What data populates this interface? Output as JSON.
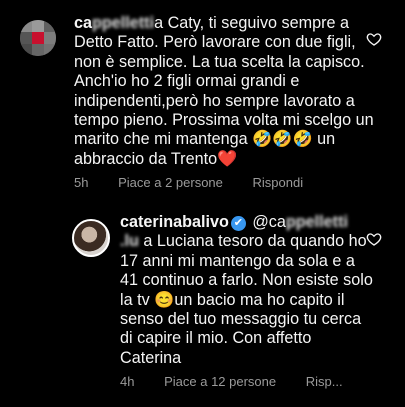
{
  "comment1": {
    "username": "ca",
    "username_blurred": "ppelletti",
    "text": "a Caty, ti seguivo sempre a Detto Fatto. Però lavorare con due figli, non è semplice. La tua scelta la capisco. Anch'io ho 2 figli ormai grandi e indipendenti,però ho sempre lavorato a tempo pieno. Prossima volta mi scelgo un marito che mi mantenga 🤣🤣🤣 un abbraccio da Trento❤️",
    "time": "5h",
    "likes": "Piace a 2 persone",
    "reply": "Rispondi"
  },
  "comment2": {
    "username": "caterinabalivo",
    "mention_prefix": "@ca",
    "mention_blurred": "ppelletti",
    "mention_line2_blurred": ".lu",
    "mention_line2_rest": "a Luciana tesoro da quando ho 17 anni mi mantengo da sola e a 41 continuo a farlo. Non esiste solo la tv 😊un bacio ma ho capito il senso del tuo messaggio tu cerca di capire il mio. Con affetto Caterina",
    "time": "4h",
    "likes": "Piace a 12 persone",
    "reply": "Risp..."
  },
  "icons": {
    "heart": "heart-outline-icon",
    "verified": "verified-badge-icon"
  },
  "colors": {
    "background": "#000000",
    "text": "#f5f5f5",
    "meta": "#9a9a9a",
    "verified": "#3897f0"
  }
}
